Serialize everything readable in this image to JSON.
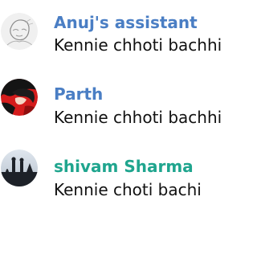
{
  "messages": [
    {
      "sender": "Anuj's assistant",
      "sender_color": "#4a7ec4",
      "text": "Kennie chhoti bachhi",
      "avatar_icon": "sketch-avatar-icon"
    },
    {
      "sender": "Parth",
      "sender_color": "#4a7ec4",
      "text": "Kennie chhoti bachhi",
      "avatar_icon": "red-black-anime-avatar-icon"
    },
    {
      "sender": "shivam Sharma",
      "sender_color": "#1fa58e",
      "text": "Kennie choti bachi",
      "avatar_icon": "silhouette-photo-avatar-icon"
    }
  ]
}
